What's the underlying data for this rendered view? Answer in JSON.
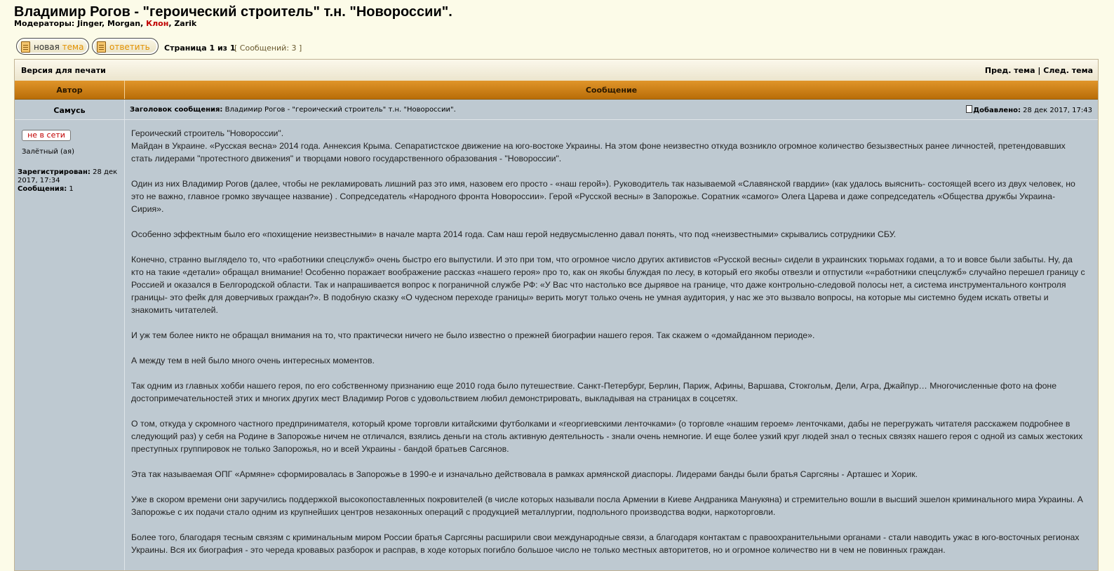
{
  "topic": {
    "title": "Владимир Рогов - \"героический строитель\" т.н. \"Новороссии\".",
    "moderators_label": "Модераторы:",
    "moderators": [
      "Jinger",
      "Morgan",
      "Клон",
      "Zarik"
    ]
  },
  "toolbar": {
    "new_topic_word1": "новая",
    "new_topic_word2": "тема",
    "reply_label": "ответить",
    "pagination": "Страница 1 из 1",
    "message_count": "[ Сообщений: 3 ]"
  },
  "printbar": {
    "print_label": "Версия для печати",
    "prev_topic": "Пред. тема",
    "divider": "|",
    "next_topic": "След. тема"
  },
  "table_head": {
    "author": "Автор",
    "message": "Сообщение"
  },
  "post": {
    "author": "Самусь",
    "subject_label": "Заголовок сообщения:",
    "subject": "Владимир Рогов - \"героический строитель\" т.н. \"Новороссии\".",
    "posted_label": "Добавлено:",
    "posted_date": "28 дек 2017, 17:43",
    "status": "не в сети",
    "rank": "Залётный (ая)",
    "registered_label": "Зарегистрирован:",
    "registered_date": "28 дек 2017, 17:34",
    "messages_label": "Сообщения:",
    "messages_count": "1",
    "paragraphs": [
      "Героический строитель \"Новороссии\".\nМайдан в Украине. «Русская весна» 2014 года. Аннексия Крыма. Сепаратистское движение на юго-востоке Украины. На этом фоне неизвестно откуда возникло огромное количество безызвестных ранее личностей, претендовавших стать лидерами \"протестного движения\" и творцами нового государственного образования - \"Новороссии\".",
      "Один из них Владимир Рогов (далее, чтобы не рекламировать лишний раз это имя, назовем его просто - «наш герой»). Руководитель так называемой «Славянской гвардии» (как удалось выяснить- состоящей всего из двух человек, но это не важно, главное громко звучащее название) . Сопредседатель «Народного фронта Новороссии». Герой «Русской весны» в Запорожье. Соратник «самого» Олега Царева и даже сопредседатель «Общества дружбы Украина-Сирия».",
      "Особенно эффектным было его «похищение неизвестными» в начале марта 2014 года. Сам наш герой недвусмысленно давал понять, что под «неизвестными» скрывались сотрудники СБУ.",
      "Конечно, странно выглядело то, что «работники спецслужб» очень быстро его выпустили. И это при том, что огромное число других активистов «Русской весны» сидели в украинских тюрьмах годами, а то и вовсе были забыты. Ну, да кто на такие «детали» обращал внимание! Особенно поражает воображение рассказ «нашего героя» про то, как он якобы блуждая по лесу, в который его якобы отвезли и отпустили ««работники спецслужб» случайно перешел границу с Россией и оказался в Белгородской области. Так и напрашивается вопрос к пограничной службе РФ: «У Вас что настолько все дырявое на границе, что даже контрольно-следовой полосы нет, а система инструментального контроля границы- это фейк для доверчивых граждан?». В подобную сказку «О чудесном переходе границы» верить могут только очень не умная аудитория, у нас же это вызвало вопросы, на которые мы системно будем искать ответы и знакомить читателей.",
      "И уж тем более никто не обращал внимания на то, что практически ничего не было известно о прежней биографии нашего героя. Так скажем о «домайданном периоде».",
      "А между тем в ней было много очень интересных моментов.",
      "Так одним из главных хобби нашего героя, по его собственному признанию еще 2010 года было путешествие. Санкт-Петербург, Берлин, Париж, Афины, Варшава, Стокгольм, Дели, Агра, Джайпур… Многочисленные фото на фоне достопримечательностей этих и многих других мест Владимир Рогов с удовольствием любил демонстрировать, выкладывая на страницах в соцсетях.",
      "О том, откуда у скромного частного предпринимателя, который кроме торговли китайскими футболками и «георгиевскими ленточками» (о торговле «нашим героем» ленточками, дабы не перегружать читателя расскажем подробнее в следующий раз) у себя на Родине в Запорожье ничем не отличался, взялись деньги на столь активную деятельность - знали очень немногие. И еще более узкий круг людей знал о тесных связях нашего героя с одной из самых жестоких преступных группировок не только Запорожья, но и всей Украины - бандой братьев Сагсянов.",
      "Эта так называемая ОПГ «Армяне» сформировалась в Запорожье в 1990-е и изначально действовала в рамках армянской диаспоры. Лидерами банды были братья Саргсяны - Арташес и Хорик.",
      "Уже в скором времени они заручились поддержкой высокопоставленных покровителей (в числе которых называли посла Армении в Киеве Андраника Манукяна) и стремительно вошли в высший эшелон криминального мира Украины. А Запорожье с их подачи стало одним из крупнейших центров незаконных операций с продукцией металлургии, подпольного производства водки, наркоторговли.",
      "Более того, благодаря тесным связям с криминальным миром России братья Саргсяны расширили свои международные связи, а благодаря контактам с правоохранительными органами - стали наводить ужас в юго-восточных регионах Украины. Вся их биография - это череда кровавых разборок и расправ, в ходе которых погибло большое число не только местных авторитетов, но и огромное количество ни в чем не повинных граждан."
    ]
  }
}
